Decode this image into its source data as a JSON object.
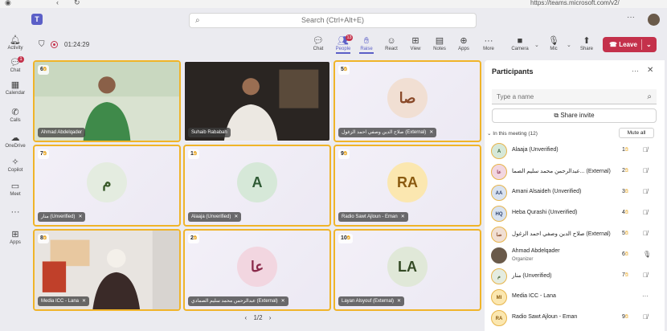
{
  "browser": {
    "url": "https://teams.microsoft.com/v2/"
  },
  "search": {
    "placeholder": "Search (Ctrl+Alt+E)"
  },
  "rail": [
    {
      "label": "Activity",
      "icon": "bell-icon"
    },
    {
      "label": "Chat",
      "icon": "chat-icon",
      "badge": "1"
    },
    {
      "label": "Calendar",
      "icon": "calendar-icon"
    },
    {
      "label": "Calls",
      "icon": "phone-icon"
    },
    {
      "label": "OneDrive",
      "icon": "cloud-icon"
    },
    {
      "label": "Copilot",
      "icon": "copilot-icon"
    },
    {
      "label": "Meet",
      "icon": "video-icon"
    },
    {
      "label": "Apps",
      "icon": "apps-plus-icon"
    }
  ],
  "meeting": {
    "timer": "01:24:29",
    "toolbar": {
      "chat": "Chat",
      "people": "People",
      "people_badge": "13",
      "raise": "Raise",
      "react": "React",
      "view": "View",
      "notes": "Notes",
      "apps": "Apps",
      "more": "More",
      "camera": "Camera",
      "mic": "Mic",
      "share": "Share",
      "leave": "Leave"
    },
    "pager": "1/2"
  },
  "tiles": [
    {
      "name": "Ahmad Abdelqader",
      "hand": "6",
      "type": "video"
    },
    {
      "name": "Suhaib Rababah",
      "hand": "",
      "type": "video"
    },
    {
      "name": "صلاح الدين وصفي احمد الزغول (External)",
      "hand": "5",
      "initials": "صا"
    },
    {
      "name": "منار (Unverified)",
      "hand": "7",
      "initials": "م"
    },
    {
      "name": "Alaaja (Unverified)",
      "hand": "1",
      "initials": "A"
    },
    {
      "name": "Radio Sawt Ajloun - Eman",
      "hand": "9",
      "initials": "RA"
    },
    {
      "name": "Media ICC - Lana",
      "hand": "8",
      "type": "video"
    },
    {
      "name": "عبدالرحمن محمد سليم الصمادي (External)",
      "hand": "2",
      "initials": "عا"
    },
    {
      "name": "Layan Alsyouf (External)",
      "hand": "10",
      "initials": "LA"
    }
  ],
  "participants": {
    "title": "Participants",
    "search_placeholder": "Type a name",
    "share_invite": "Share invite",
    "in_meeting": "In this meeting (12)",
    "mute_all": "Mute all",
    "list": [
      {
        "initials": "A",
        "name": "Alaaja (Unverified)",
        "hand": "1"
      },
      {
        "initials": "عا",
        "name": "عبدالرحمن محمد سليم الصما... (External)",
        "hand": "2"
      },
      {
        "initials": "AA",
        "name": "Amani Alsaideh (Unverified)",
        "hand": "3"
      },
      {
        "initials": "HQ",
        "name": "Heba Qurashi (Unverified)",
        "hand": "4"
      },
      {
        "initials": "صا",
        "name": "صلاح الدين وصفي احمد الزغول (External)",
        "hand": "5"
      },
      {
        "initials": "",
        "name": "Ahmad Abdelqader",
        "sub": "Organizer",
        "hand": "6"
      },
      {
        "initials": "م",
        "name": "منار (Unverified)",
        "hand": "7"
      },
      {
        "initials": "MI",
        "name": "Media ICC - Lana",
        "hand": ""
      },
      {
        "initials": "RA",
        "name": "Radio Sawt Ajloun - Eman",
        "hand": "9"
      }
    ]
  }
}
